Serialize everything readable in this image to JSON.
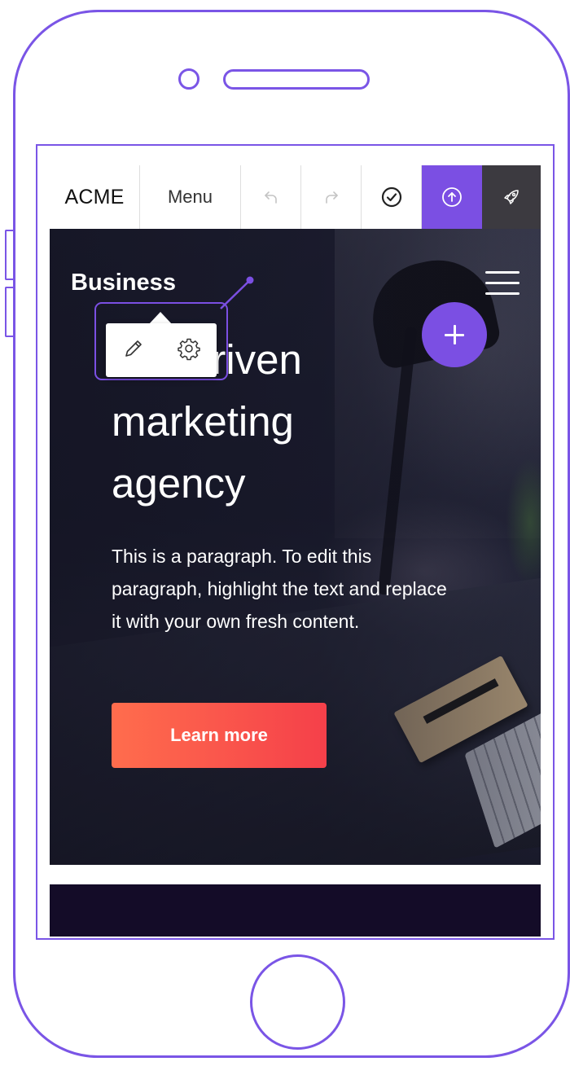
{
  "toolbar": {
    "brand": "ACME",
    "menu_label": "Menu",
    "undo_icon": "undo-icon",
    "redo_icon": "redo-icon",
    "check_icon": "check-circle-icon",
    "publish_icon": "upload-circle-icon",
    "rocket_icon": "rocket-icon",
    "accent_color": "#7b4fe3",
    "dark_color": "#3c3a40"
  },
  "hero": {
    "brand": "Business",
    "title_lines": [
      "-driven",
      "marketing",
      "agency"
    ],
    "paragraph": "This is a paragraph. To edit this paragraph, highlight the text and replace it with your own fresh content.",
    "cta_label": "Learn more",
    "cta_gradient": [
      "#ff6d4d",
      "#f5404a"
    ]
  },
  "editor_popover": {
    "edit_icon": "pencil-icon",
    "settings_icon": "gear-icon"
  },
  "fab": {
    "icon": "plus-icon"
  },
  "frame": {
    "color": "#7a55e6"
  }
}
